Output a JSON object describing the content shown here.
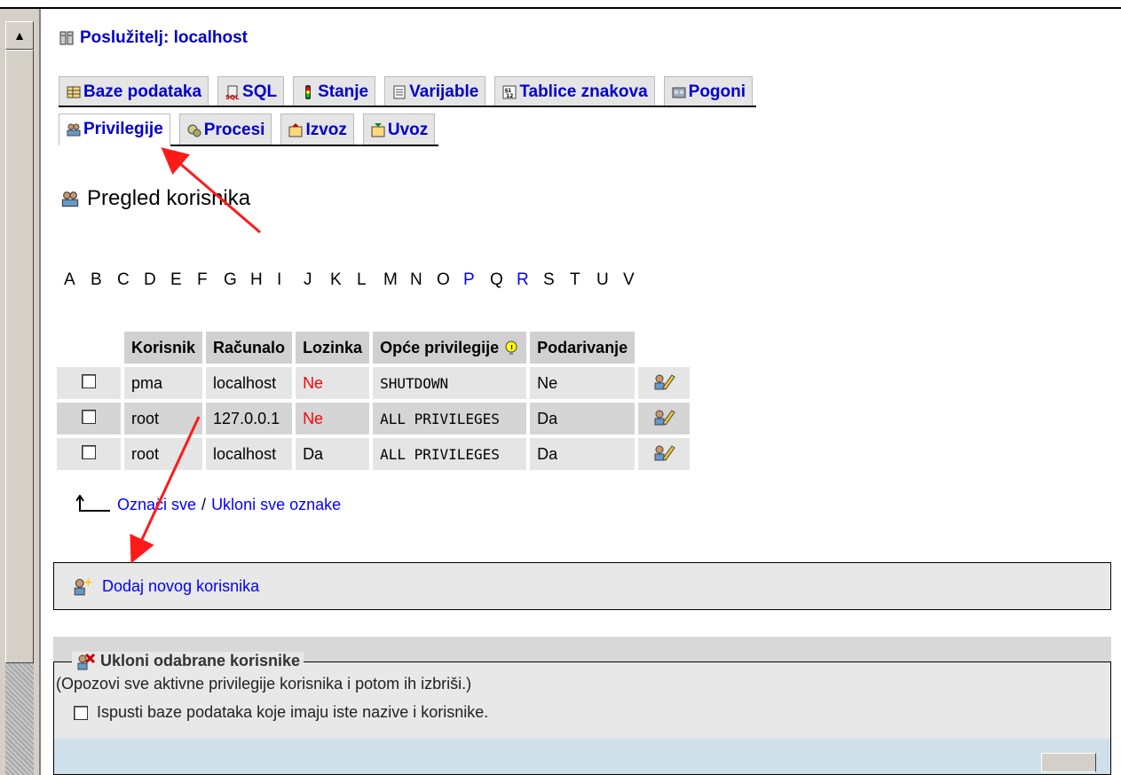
{
  "header": {
    "server_label": "Poslužitelj: localhost"
  },
  "tabs_row1": [
    {
      "label": "Baze podataka",
      "icon": "database-icon"
    },
    {
      "label": "SQL",
      "icon": "sql-icon"
    },
    {
      "label": "Stanje",
      "icon": "status-icon"
    },
    {
      "label": "Varijable",
      "icon": "variables-icon"
    },
    {
      "label": "Tablice znakova",
      "icon": "charset-icon"
    },
    {
      "label": "Pogoni",
      "icon": "engines-icon"
    }
  ],
  "tabs_row2": [
    {
      "label": "Privilegije",
      "icon": "privileges-icon",
      "active": true
    },
    {
      "label": "Procesi",
      "icon": "processes-icon"
    },
    {
      "label": "Izvoz",
      "icon": "export-icon"
    },
    {
      "label": "Uvoz",
      "icon": "import-icon"
    }
  ],
  "page_title": "Pregled korisnika",
  "alphabet": [
    "A",
    "B",
    "C",
    "D",
    "E",
    "F",
    "G",
    "H",
    "I",
    "J",
    "K",
    "L",
    "M",
    "N",
    "O",
    "P",
    "Q",
    "R",
    "S",
    "T",
    "U",
    "V"
  ],
  "alphabet_links": [
    "P",
    "R"
  ],
  "table": {
    "headers": [
      "Korisnik",
      "Računalo",
      "Lozinka",
      "Opće privilegije",
      "Podarivanje"
    ],
    "rows": [
      {
        "user": "pma",
        "host": "localhost",
        "password": "Ne",
        "privileges": "SHUTDOWN",
        "grant": "Ne"
      },
      {
        "user": "root",
        "host": "127.0.0.1",
        "password": "Ne",
        "privileges": "ALL PRIVILEGES",
        "grant": "Da"
      },
      {
        "user": "root",
        "host": "localhost",
        "password": "Da",
        "privileges": "ALL PRIVILEGES",
        "grant": "Da"
      }
    ]
  },
  "check_all": {
    "check": "Označi sve",
    "separator": "/",
    "uncheck": "Ukloni sve oznake"
  },
  "add_user": "Dodaj novog korisnika",
  "remove": {
    "legend": "Ukloni odabrane korisnike",
    "description": "(Opozovi sve aktivne privilegije korisnika i potom ih izbriši.)",
    "drop_db_label": "Ispusti baze podataka koje imaju iste nazive i korisnike."
  },
  "colors": {
    "link": "#0000cc",
    "no": "#ff0000",
    "annotation": "#ff1a1a"
  }
}
